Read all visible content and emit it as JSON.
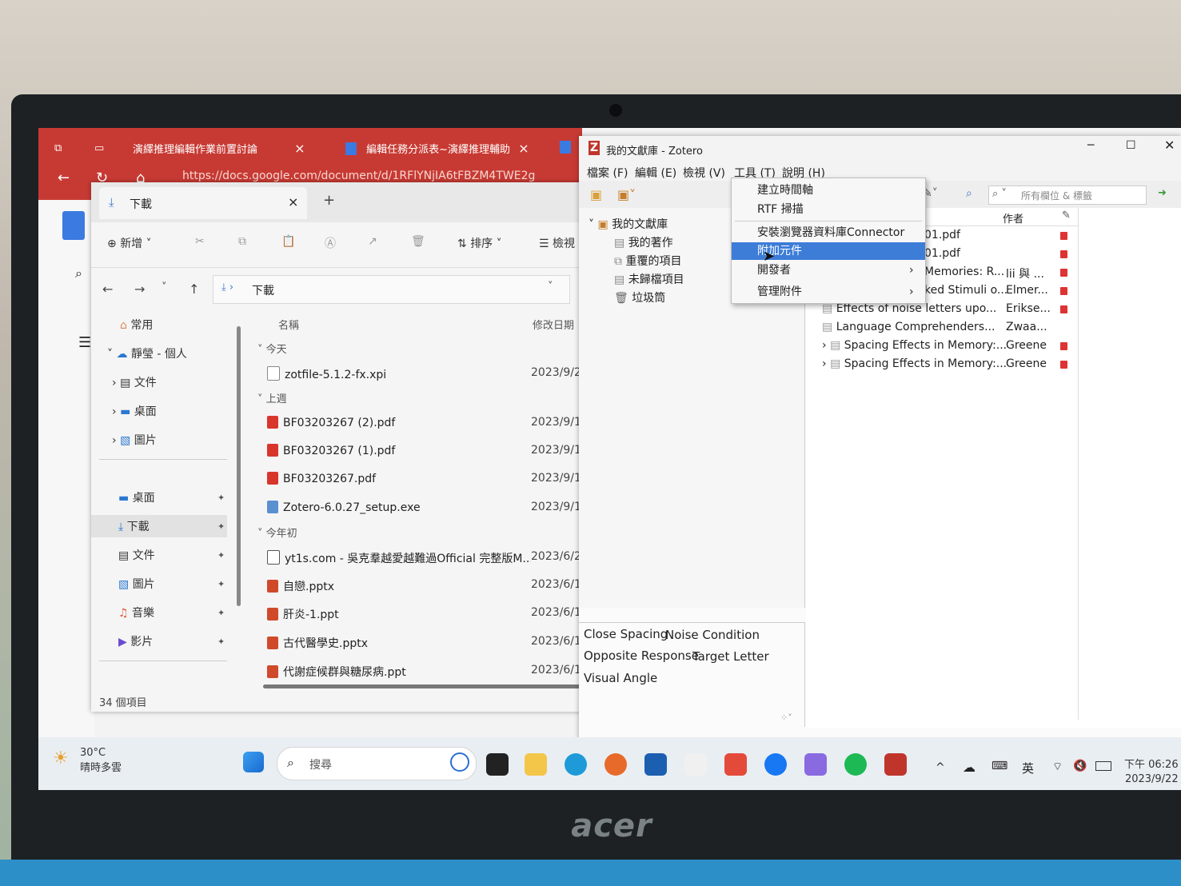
{
  "browser": {
    "tab1_title": "演繹推理編輯作業前置討論",
    "tab2_title": "編輯任務分派表~演繹推理輔助",
    "url": "https://docs.google.com/document/d/1RFlYNjIA6tFBZM4TWE2g"
  },
  "explorer": {
    "tab_title": "下載",
    "toolbar": {
      "new": "新增",
      "sort": "排序",
      "view": "檢視"
    },
    "address": "下載",
    "nav": {
      "home": "常用",
      "onedrive": "靜瑩 - 個人",
      "documents": "文件",
      "desktop": "桌面",
      "pictures": "圖片",
      "pinned_desktop": "桌面",
      "pinned_downloads": "下載",
      "pinned_documents": "文件",
      "pinned_pictures": "圖片",
      "pinned_music": "音樂",
      "pinned_videos": "影片"
    },
    "columns": {
      "name": "名稱",
      "modified": "修改日期"
    },
    "groups": {
      "today": "今天",
      "last_week": "上週",
      "early_this_year": "今年初"
    },
    "files": [
      {
        "name": "zotfile-5.1.2-fx.xpi",
        "date": "2023/9/2"
      },
      {
        "name": "BF03203267 (2).pdf",
        "date": "2023/9/1"
      },
      {
        "name": "BF03203267 (1).pdf",
        "date": "2023/9/1"
      },
      {
        "name": "BF03203267.pdf",
        "date": "2023/9/1"
      },
      {
        "name": "Zotero-6.0.27_setup.exe",
        "date": "2023/9/1"
      },
      {
        "name": "yt1s.com - 吳克羣越愛越難過Official 完整版M...",
        "date": "2023/6/2"
      },
      {
        "name": "自戀.pptx",
        "date": "2023/6/1"
      },
      {
        "name": "肝炎-1.ppt",
        "date": "2023/6/1"
      },
      {
        "name": "古代醫學史.pptx",
        "date": "2023/6/1"
      },
      {
        "name": "代謝症候群與糖尿病.ppt",
        "date": "2023/6/1"
      }
    ],
    "status": "34 個項目"
  },
  "zotero": {
    "title": "我的文獻庫 - Zotero",
    "menu": {
      "file": "檔案 (F)",
      "edit": "編輯 (E)",
      "view": "檢視 (V)",
      "tools": "工具 (T)",
      "help": "說明 (H)"
    },
    "search_placeholder": "所有欄位 & 標籤",
    "collections": {
      "library": "我的文獻庫",
      "my_publications": "我的著作",
      "duplicates": "重覆的項目",
      "unfiled": "未歸檔項目",
      "trash": "垃圾筒"
    },
    "tools_menu": [
      {
        "label": "建立時間軸"
      },
      {
        "label": "RTF 掃描"
      },
      {
        "label": "安裝瀏覽器資料庫Connector"
      },
      {
        "label": "附加元件"
      },
      {
        "label": "開發者"
      },
      {
        "label": "管理附件"
      }
    ],
    "tags": [
      "Close Spacing",
      "Noise Condition",
      "Opposite Response",
      "Target Letter",
      "Visual Angle"
    ],
    "items_header": {
      "creator": "作者"
    },
    "items": [
      {
        "title": "01.pdf",
        "creator": ""
      },
      {
        "title": "01.pdf",
        "creator": ""
      },
      {
        "title": "Memories: R...",
        "creator": "lii 與 ..."
      },
      {
        "title": "ked Stimuli o...",
        "creator": "Elmer..."
      },
      {
        "title": "Effects of noise letters upo...",
        "creator": "Erikse..."
      },
      {
        "title": "Language Comprehenders...",
        "creator": "Zwaa..."
      },
      {
        "title": "Spacing Effects in Memory:...",
        "creator": "Greene"
      },
      {
        "title": "Spacing Effects in Memory:...",
        "creator": "Greene"
      }
    ]
  },
  "taskbar": {
    "temperature": "30°C",
    "weather_desc": "晴時多雲",
    "search": "搜尋",
    "lang": "英",
    "time": "下午 06:26",
    "date": "2023/9/22"
  },
  "colors": {
    "browser_accent": "#c73a33",
    "selection": "#3d7dd8",
    "zotero_red": "#c0352b"
  }
}
